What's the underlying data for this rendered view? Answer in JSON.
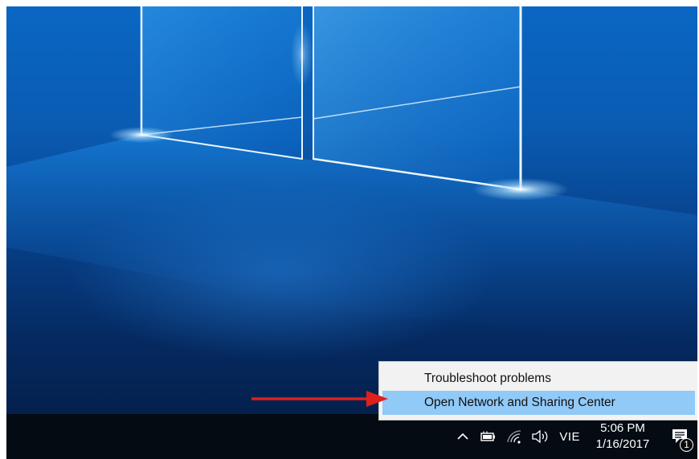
{
  "context_menu": {
    "items": [
      {
        "label": "Troubleshoot problems",
        "highlighted": false
      },
      {
        "label": "Open Network and Sharing Center",
        "highlighted": true
      }
    ],
    "highlight_color": "#91c9f7"
  },
  "taskbar": {
    "tray": {
      "icons": [
        "chevron-up-icon",
        "battery-icon",
        "wifi-icon",
        "volume-icon"
      ],
      "language": "VIE",
      "time": "5:06 PM",
      "date": "1/16/2017",
      "notification_count": "1"
    }
  },
  "annotation": {
    "type": "arrow",
    "color": "#e0201b"
  },
  "wallpaper": {
    "accent": "#0a67c3",
    "dark": "#04204d"
  }
}
